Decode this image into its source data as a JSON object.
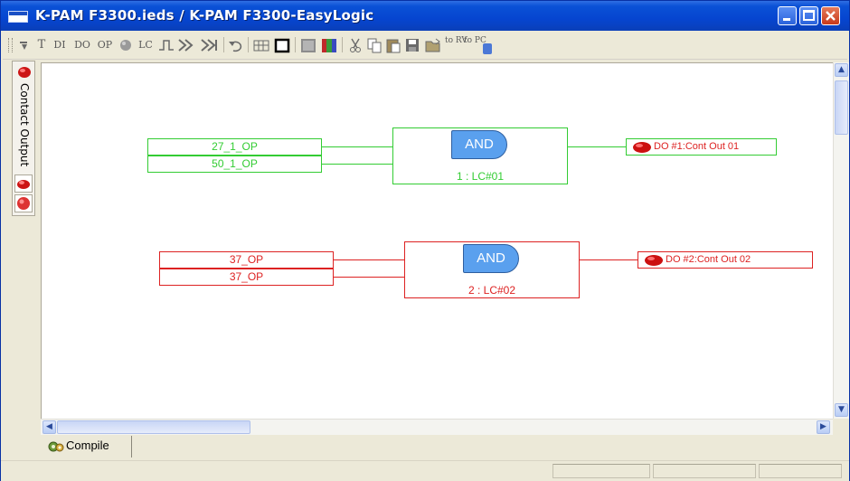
{
  "window": {
    "title": "K-PAM F3300.ieds / K-PAM F3300-EasyLogic"
  },
  "toolbar": {
    "items": [
      "T",
      "DI",
      "DO",
      "OP",
      "LC"
    ],
    "rv_label": "to RV",
    "pc_label": "to PC"
  },
  "sidebar": {
    "tab_label": "Contact Output"
  },
  "diagram": {
    "logic1": {
      "inputs": [
        "27_1_OP",
        "50_1_OP"
      ],
      "gate": "AND",
      "label": "1 : LC#01",
      "output": "DO #1:Cont Out 01",
      "color": "#33cc33"
    },
    "logic2": {
      "inputs": [
        "37_OP",
        "37_OP"
      ],
      "gate": "AND",
      "label": "2 : LC#02",
      "output": "DO #2:Cont Out 02",
      "color": "#dd2222"
    }
  },
  "bottom": {
    "compile_label": "Compile"
  },
  "colors": {
    "titlebar": "#0a51d6",
    "gate_fill": "#5aa0ee"
  }
}
